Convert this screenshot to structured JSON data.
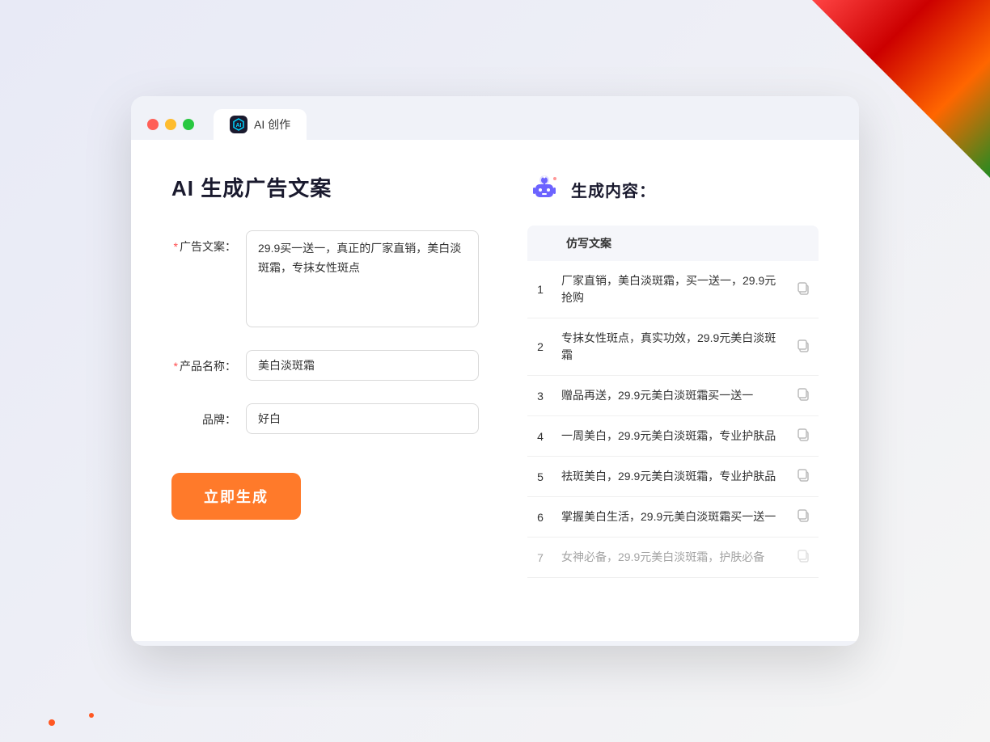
{
  "browser": {
    "tab_icon": "AI",
    "tab_label": "AI 创作"
  },
  "page": {
    "title": "AI 生成广告文案"
  },
  "form": {
    "ad_copy_label": "广告文案：",
    "ad_copy_required": "*",
    "ad_copy_value": "29.9买一送一，真正的厂家直销，美白淡斑霜，专抹女性斑点",
    "product_name_label": "产品名称：",
    "product_name_required": "*",
    "product_name_value": "美白淡斑霜",
    "brand_label": "品牌：",
    "brand_value": "好白",
    "generate_btn": "立即生成"
  },
  "result": {
    "title": "生成内容：",
    "column_label": "仿写文案",
    "items": [
      {
        "num": "1",
        "text": "厂家直销，美白淡斑霜，买一送一，29.9元抢购"
      },
      {
        "num": "2",
        "text": "专抹女性斑点，真实功效，29.9元美白淡斑霜"
      },
      {
        "num": "3",
        "text": "赠品再送，29.9元美白淡斑霜买一送一"
      },
      {
        "num": "4",
        "text": "一周美白，29.9元美白淡斑霜，专业护肤品"
      },
      {
        "num": "5",
        "text": "祛斑美白，29.9元美白淡斑霜，专业护肤品"
      },
      {
        "num": "6",
        "text": "掌握美白生活，29.9元美白淡斑霜买一送一"
      },
      {
        "num": "7",
        "text": "女神必备，29.9元美白淡斑霜，护肤必备"
      }
    ]
  }
}
